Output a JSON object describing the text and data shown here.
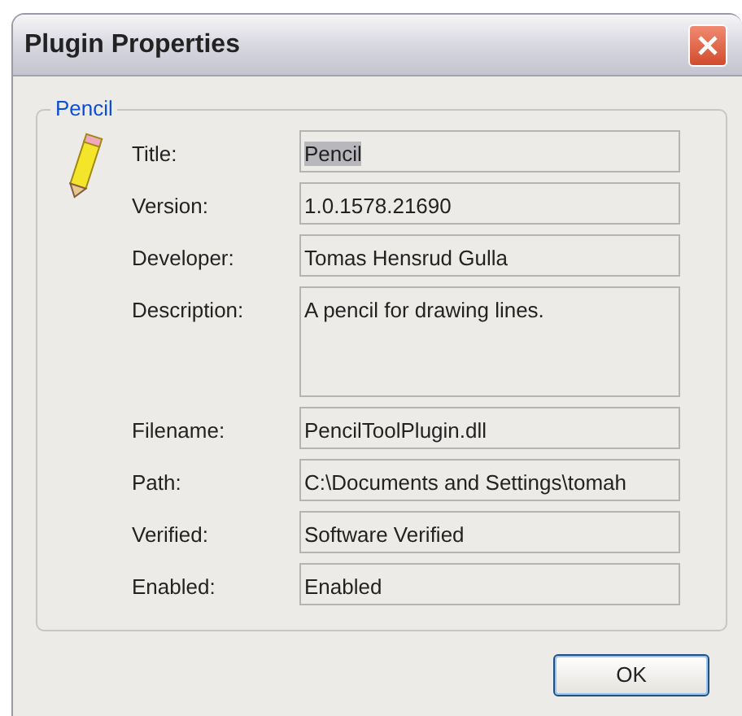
{
  "window": {
    "title": "Plugin Properties"
  },
  "group": {
    "legend": "Pencil"
  },
  "fields": [
    {
      "label": "Title:",
      "value": "Pencil",
      "multiline": false,
      "text_selected": true
    },
    {
      "label": "Version:",
      "value": "1.0.1578.21690",
      "multiline": false,
      "text_selected": false
    },
    {
      "label": "Developer:",
      "value": "Tomas Hensrud Gulla",
      "multiline": false,
      "text_selected": false
    },
    {
      "label": "Description:",
      "value": "A pencil for drawing lines.",
      "multiline": true,
      "text_selected": false
    },
    {
      "label": "Filename:",
      "value": "PencilToolPlugin.dll",
      "multiline": false,
      "text_selected": false
    },
    {
      "label": "Path:",
      "value": "C:\\Documents and Settings\\tomah",
      "multiline": false,
      "text_selected": false
    },
    {
      "label": "Verified:",
      "value": "Software Verified",
      "multiline": false,
      "text_selected": false
    },
    {
      "label": "Enabled:",
      "value": "Enabled",
      "multiline": false,
      "text_selected": false
    }
  ],
  "buttons": [
    {
      "label": "OK"
    }
  ]
}
